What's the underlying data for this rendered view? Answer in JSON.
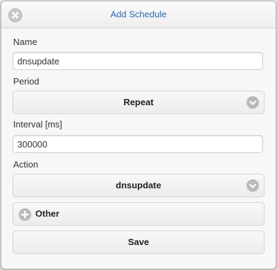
{
  "dialog": {
    "title": "Add Schedule",
    "close_icon": "close-icon"
  },
  "form": {
    "name_label": "Name",
    "name_value": "dnsupdate",
    "period_label": "Period",
    "period_value": "Repeat",
    "interval_label": "Interval [ms]",
    "interval_value": "300000",
    "action_label": "Action",
    "action_value": "dnsupdate",
    "other_label": "Other",
    "save_label": "Save"
  },
  "icons": {
    "select": "chevron-down-icon",
    "expand": "plus-icon"
  },
  "colors": {
    "title": "#2a6bb4",
    "icon_bg": "#b9b9b9"
  }
}
